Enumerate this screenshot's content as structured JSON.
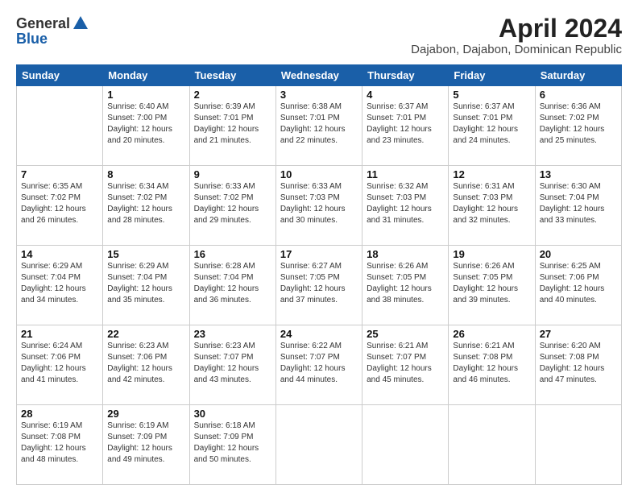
{
  "logo": {
    "general": "General",
    "blue": "Blue"
  },
  "title": "April 2024",
  "subtitle": "Dajabon, Dajabon, Dominican Republic",
  "headers": [
    "Sunday",
    "Monday",
    "Tuesday",
    "Wednesday",
    "Thursday",
    "Friday",
    "Saturday"
  ],
  "weeks": [
    [
      {
        "day": "",
        "sunrise": "",
        "sunset": "",
        "daylight": ""
      },
      {
        "day": "1",
        "sunrise": "Sunrise: 6:40 AM",
        "sunset": "Sunset: 7:00 PM",
        "daylight": "Daylight: 12 hours and 20 minutes."
      },
      {
        "day": "2",
        "sunrise": "Sunrise: 6:39 AM",
        "sunset": "Sunset: 7:01 PM",
        "daylight": "Daylight: 12 hours and 21 minutes."
      },
      {
        "day": "3",
        "sunrise": "Sunrise: 6:38 AM",
        "sunset": "Sunset: 7:01 PM",
        "daylight": "Daylight: 12 hours and 22 minutes."
      },
      {
        "day": "4",
        "sunrise": "Sunrise: 6:37 AM",
        "sunset": "Sunset: 7:01 PM",
        "daylight": "Daylight: 12 hours and 23 minutes."
      },
      {
        "day": "5",
        "sunrise": "Sunrise: 6:37 AM",
        "sunset": "Sunset: 7:01 PM",
        "daylight": "Daylight: 12 hours and 24 minutes."
      },
      {
        "day": "6",
        "sunrise": "Sunrise: 6:36 AM",
        "sunset": "Sunset: 7:02 PM",
        "daylight": "Daylight: 12 hours and 25 minutes."
      }
    ],
    [
      {
        "day": "7",
        "sunrise": "Sunrise: 6:35 AM",
        "sunset": "Sunset: 7:02 PM",
        "daylight": "Daylight: 12 hours and 26 minutes."
      },
      {
        "day": "8",
        "sunrise": "Sunrise: 6:34 AM",
        "sunset": "Sunset: 7:02 PM",
        "daylight": "Daylight: 12 hours and 28 minutes."
      },
      {
        "day": "9",
        "sunrise": "Sunrise: 6:33 AM",
        "sunset": "Sunset: 7:02 PM",
        "daylight": "Daylight: 12 hours and 29 minutes."
      },
      {
        "day": "10",
        "sunrise": "Sunrise: 6:33 AM",
        "sunset": "Sunset: 7:03 PM",
        "daylight": "Daylight: 12 hours and 30 minutes."
      },
      {
        "day": "11",
        "sunrise": "Sunrise: 6:32 AM",
        "sunset": "Sunset: 7:03 PM",
        "daylight": "Daylight: 12 hours and 31 minutes."
      },
      {
        "day": "12",
        "sunrise": "Sunrise: 6:31 AM",
        "sunset": "Sunset: 7:03 PM",
        "daylight": "Daylight: 12 hours and 32 minutes."
      },
      {
        "day": "13",
        "sunrise": "Sunrise: 6:30 AM",
        "sunset": "Sunset: 7:04 PM",
        "daylight": "Daylight: 12 hours and 33 minutes."
      }
    ],
    [
      {
        "day": "14",
        "sunrise": "Sunrise: 6:29 AM",
        "sunset": "Sunset: 7:04 PM",
        "daylight": "Daylight: 12 hours and 34 minutes."
      },
      {
        "day": "15",
        "sunrise": "Sunrise: 6:29 AM",
        "sunset": "Sunset: 7:04 PM",
        "daylight": "Daylight: 12 hours and 35 minutes."
      },
      {
        "day": "16",
        "sunrise": "Sunrise: 6:28 AM",
        "sunset": "Sunset: 7:04 PM",
        "daylight": "Daylight: 12 hours and 36 minutes."
      },
      {
        "day": "17",
        "sunrise": "Sunrise: 6:27 AM",
        "sunset": "Sunset: 7:05 PM",
        "daylight": "Daylight: 12 hours and 37 minutes."
      },
      {
        "day": "18",
        "sunrise": "Sunrise: 6:26 AM",
        "sunset": "Sunset: 7:05 PM",
        "daylight": "Daylight: 12 hours and 38 minutes."
      },
      {
        "day": "19",
        "sunrise": "Sunrise: 6:26 AM",
        "sunset": "Sunset: 7:05 PM",
        "daylight": "Daylight: 12 hours and 39 minutes."
      },
      {
        "day": "20",
        "sunrise": "Sunrise: 6:25 AM",
        "sunset": "Sunset: 7:06 PM",
        "daylight": "Daylight: 12 hours and 40 minutes."
      }
    ],
    [
      {
        "day": "21",
        "sunrise": "Sunrise: 6:24 AM",
        "sunset": "Sunset: 7:06 PM",
        "daylight": "Daylight: 12 hours and 41 minutes."
      },
      {
        "day": "22",
        "sunrise": "Sunrise: 6:23 AM",
        "sunset": "Sunset: 7:06 PM",
        "daylight": "Daylight: 12 hours and 42 minutes."
      },
      {
        "day": "23",
        "sunrise": "Sunrise: 6:23 AM",
        "sunset": "Sunset: 7:07 PM",
        "daylight": "Daylight: 12 hours and 43 minutes."
      },
      {
        "day": "24",
        "sunrise": "Sunrise: 6:22 AM",
        "sunset": "Sunset: 7:07 PM",
        "daylight": "Daylight: 12 hours and 44 minutes."
      },
      {
        "day": "25",
        "sunrise": "Sunrise: 6:21 AM",
        "sunset": "Sunset: 7:07 PM",
        "daylight": "Daylight: 12 hours and 45 minutes."
      },
      {
        "day": "26",
        "sunrise": "Sunrise: 6:21 AM",
        "sunset": "Sunset: 7:08 PM",
        "daylight": "Daylight: 12 hours and 46 minutes."
      },
      {
        "day": "27",
        "sunrise": "Sunrise: 6:20 AM",
        "sunset": "Sunset: 7:08 PM",
        "daylight": "Daylight: 12 hours and 47 minutes."
      }
    ],
    [
      {
        "day": "28",
        "sunrise": "Sunrise: 6:19 AM",
        "sunset": "Sunset: 7:08 PM",
        "daylight": "Daylight: 12 hours and 48 minutes."
      },
      {
        "day": "29",
        "sunrise": "Sunrise: 6:19 AM",
        "sunset": "Sunset: 7:09 PM",
        "daylight": "Daylight: 12 hours and 49 minutes."
      },
      {
        "day": "30",
        "sunrise": "Sunrise: 6:18 AM",
        "sunset": "Sunset: 7:09 PM",
        "daylight": "Daylight: 12 hours and 50 minutes."
      },
      {
        "day": "",
        "sunrise": "",
        "sunset": "",
        "daylight": ""
      },
      {
        "day": "",
        "sunrise": "",
        "sunset": "",
        "daylight": ""
      },
      {
        "day": "",
        "sunrise": "",
        "sunset": "",
        "daylight": ""
      },
      {
        "day": "",
        "sunrise": "",
        "sunset": "",
        "daylight": ""
      }
    ]
  ]
}
